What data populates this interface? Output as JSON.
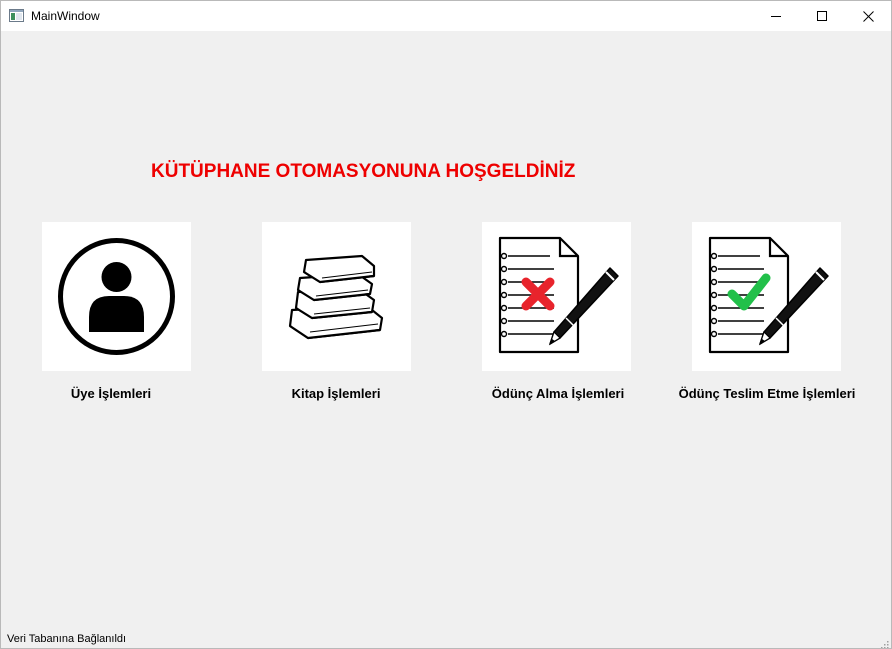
{
  "window": {
    "title": "MainWindow",
    "icons": {
      "app": "window-app-icon",
      "minimize": "minimize-icon",
      "maximize": "maximize-icon",
      "close": "close-icon"
    }
  },
  "main": {
    "welcome_text": "KÜTÜPHANE OTOMASYONUNA HOŞGELDİNİZ",
    "tiles": [
      {
        "label": "Üye İşlemleri",
        "icon": "user-icon"
      },
      {
        "label": "Kitap İşlemleri",
        "icon": "books-icon"
      },
      {
        "label": "Ödünç Alma İşlemleri",
        "icon": "document-cross-icon"
      },
      {
        "label": "Ödünç Teslim Etme İşlemleri",
        "icon": "document-check-icon"
      }
    ]
  },
  "statusbar": {
    "text": "Veri Tabanına Bağlanıldı"
  },
  "colors": {
    "welcome": "#ee0000",
    "cross": "#e8242c",
    "check": "#22c04a",
    "window_bg": "#f0f0f0"
  }
}
